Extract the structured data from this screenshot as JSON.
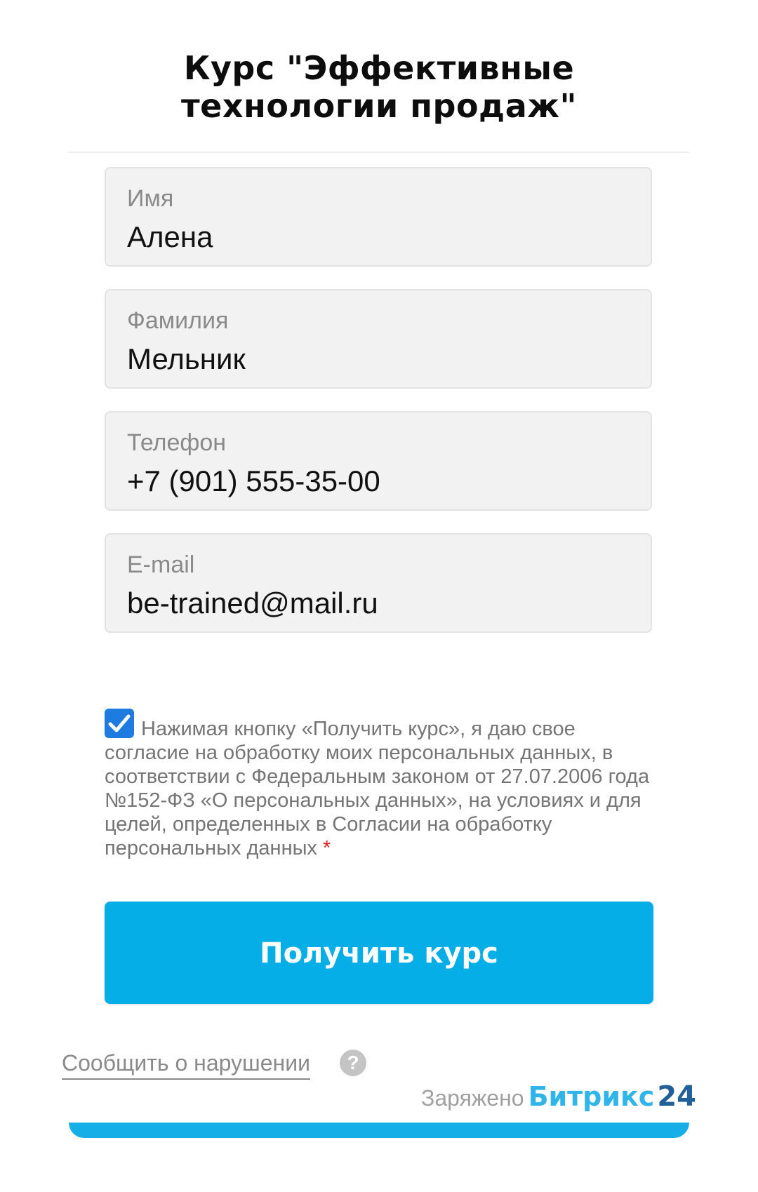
{
  "form": {
    "title_line1": "Курс \"Эффективные",
    "title_line2": "технологии продаж\"",
    "fields": [
      {
        "label": "Имя",
        "value": "Алена"
      },
      {
        "label": "Фамилия",
        "value": "Мельник"
      },
      {
        "label": "Телефон",
        "value": "+7 (901) 555-35-00"
      },
      {
        "label": "E-mail",
        "value": "be-trained@mail.ru"
      }
    ],
    "consent": {
      "checked": true,
      "text": "Нажимая кнопку «Получить курс», я даю свое согласие на обработку моих персональных данных, в соответствии с Федеральным законом от 27.07.2006 года №152-ФЗ «О персональных данных», на условиях и для целей, определенных в Согласии на обработку персональных данных",
      "required_mark": "*"
    },
    "submit_label": "Получить курс"
  },
  "footer": {
    "report_link": "Сообщить о нарушении",
    "help_icon": "?",
    "powered_text": "Заряжено",
    "brand_text": "Битрикс",
    "brand_number": "24"
  },
  "colors": {
    "accent": "#06aee8",
    "checkbox": "#1e7be0",
    "brand_light": "#2fb5ea",
    "brand_dark": "#215f98",
    "required": "#e02020"
  },
  "icons": {
    "checkbox": "checkmark-icon",
    "help": "question-circle-icon"
  }
}
